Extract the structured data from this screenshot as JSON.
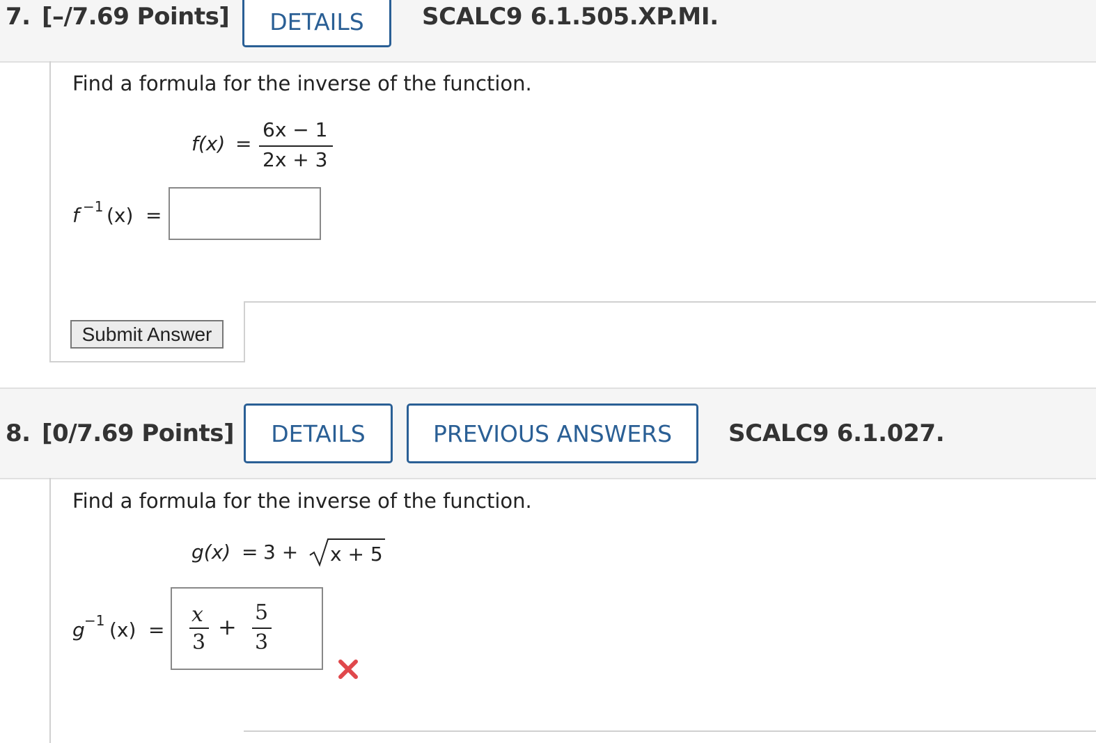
{
  "q7": {
    "number": "7.",
    "points": "[–/7.69 Points]",
    "details_label": "DETAILS",
    "code": "SCALC9 6.1.505.XP.MI.",
    "prompt": "Find a formula for the inverse of the function.",
    "function_lhs": "f(x)",
    "equals": "=",
    "numerator": "6x − 1",
    "denominator": "2x + 3",
    "inverse_lhs_base": "f",
    "inverse_lhs_exp": "−1",
    "inverse_lhs_arg": "(x)",
    "answer_value": "",
    "submit_label": "Submit Answer"
  },
  "q8": {
    "number": "8.",
    "points": "[0/7.69 Points]",
    "details_label": "DETAILS",
    "previous_label": "PREVIOUS ANSWERS",
    "code": "SCALC9 6.1.027.",
    "prompt": "Find a formula for the inverse of the function.",
    "function_lhs": "g(x)",
    "equals": "=",
    "function_rhs": "3 +",
    "radicand": "x + 5",
    "inverse_lhs_base": "g",
    "inverse_lhs_exp": "−1",
    "inverse_lhs_arg": "(x)",
    "answer": {
      "frac1_num": "x",
      "frac1_den": "3",
      "op": "+",
      "frac2_num": "5",
      "frac2_den": "3"
    },
    "status_icon": "incorrect-x-icon",
    "status_color": "#e0484c"
  },
  "colors": {
    "accent": "#2a5f95",
    "header_bg": "#f5f5f5"
  }
}
